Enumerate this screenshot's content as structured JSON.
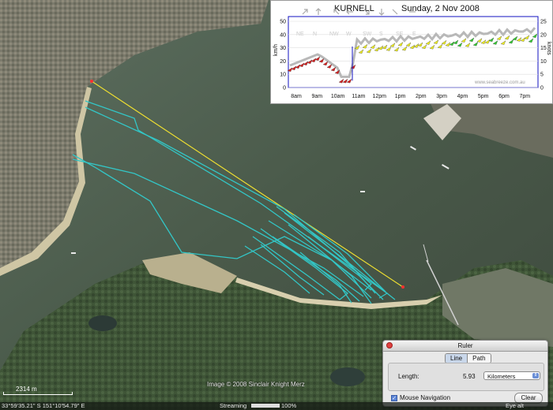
{
  "chart": {
    "title": "KURNELL",
    "date": "Sunday, 2 Nov 2008",
    "left_unit": "km/h",
    "right_unit": "knots",
    "left_ticks": [
      "50",
      "40",
      "30",
      "20",
      "10",
      "0"
    ],
    "right_ticks": [
      "25",
      "20",
      "15",
      "10",
      "5",
      "0"
    ],
    "direction_labels": [
      "NE",
      "N",
      "NW",
      "W",
      "SW",
      "S",
      "SE",
      "E"
    ],
    "time_labels": [
      "8am",
      "9am",
      "10am",
      "11am",
      "12pm",
      "1pm",
      "2pm",
      "3pm",
      "4pm",
      "5pm",
      "6pm",
      "7pm"
    ],
    "watermark": "www.seabreeze.com.au",
    "colors": {
      "light": "#d42020",
      "moderate": "#ecec20",
      "strong": "#34c834",
      "gust": "#b8b8b8",
      "frame": "#1010c0"
    }
  },
  "ruler": {
    "title": "Ruler",
    "tabs": [
      "Line",
      "Path"
    ],
    "length_label": "Length:",
    "length_value": "5.93",
    "unit": "Kilometers",
    "mouse_navigation_label": "Mouse Navigation",
    "mouse_navigation_checked": true,
    "clear_label": "Clear"
  },
  "map": {
    "scale_label": "2314 m",
    "credit": "Image © 2008 Sinclair Knight Merz",
    "coordinates": "33°59'35.21\" S  151°10'54.79\" E",
    "streaming_label": "Streaming",
    "streaming_percent": "100%",
    "eye_alt": "Eye alt",
    "ruler_line_color": "#f0e030",
    "track_color": "#33c6c6"
  }
}
